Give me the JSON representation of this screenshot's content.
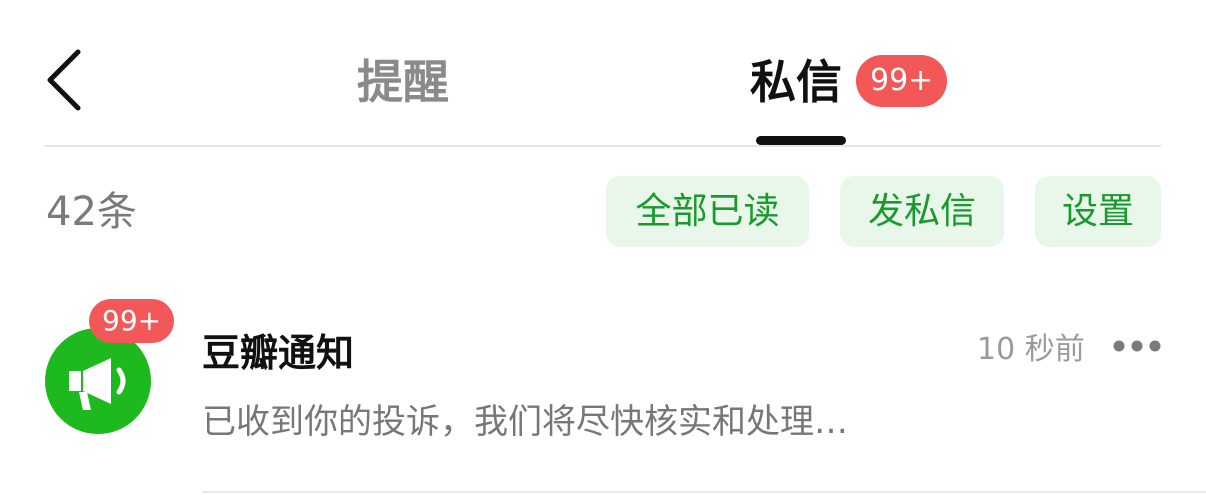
{
  "header": {
    "tabs": [
      {
        "label": "提醒",
        "active": false
      },
      {
        "label": "私信",
        "active": true,
        "badge": "99+"
      }
    ]
  },
  "toolbar": {
    "count": "42条",
    "actions": [
      {
        "label": "全部已读"
      },
      {
        "label": "发私信"
      },
      {
        "label": "设置"
      }
    ]
  },
  "messages": [
    {
      "title": "豆瓣通知",
      "preview": "已收到你的投诉，我们将尽快核实和处理…",
      "time": "10 秒前",
      "badge": "99+",
      "icon": "megaphone-icon"
    }
  ],
  "colors": {
    "accent_green": "#1db91f",
    "pill_text_green": "#1a9a2e",
    "pill_bg": "#e9f7ea",
    "badge_red": "#f25858"
  }
}
